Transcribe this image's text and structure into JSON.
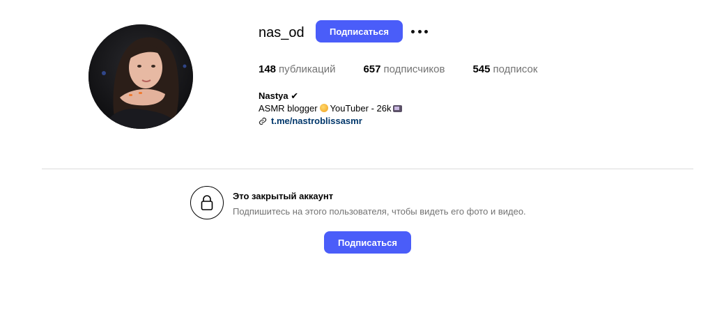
{
  "profile": {
    "username": "nas_od",
    "follow_button_label": "Подписаться",
    "more_icon": "more-dots-icon",
    "avatar_icon": "profile-avatar-photo"
  },
  "stats": {
    "posts_count": "148",
    "posts_label": "публикаций",
    "followers_count": "657",
    "followers_label": "подписчиков",
    "following_count": "545",
    "following_label": "подписок"
  },
  "bio": {
    "name": "Nastya ✔",
    "description_part1": "ASMR blogger",
    "description_part2": "YouTuber - 26k",
    "link_text": "t.me/nastroblissasmr",
    "link_icon": "link-icon"
  },
  "private": {
    "icon": "lock-icon",
    "title": "Это закрытый аккаунт",
    "subtitle": "Подпишитесь на этого пользователя, чтобы видеть его фото и видео.",
    "follow_button_label": "Подписаться"
  },
  "colors": {
    "accent": "#4a5df9",
    "link": "#00376b",
    "muted": "#737373",
    "divider": "#dbdbdb"
  }
}
